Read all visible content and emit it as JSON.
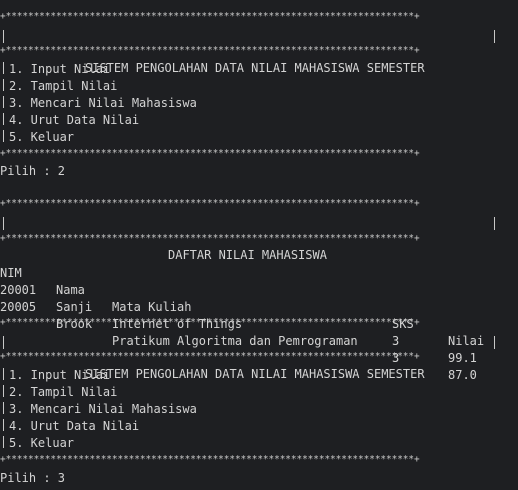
{
  "block1": {
    "border_top": "+*************************************************************************+",
    "title": "SISTEM PENGOLAHAN DATA NILAI MAHASISWA SEMESTER",
    "border_mid": "+*************************************************************************+",
    "menu": [
      "1. Input Nilai",
      "2. Tampil Nilai",
      "3. Mencari Nilai Mahasiswa",
      "4. Urut Data Nilai",
      "5. Keluar"
    ],
    "border_bottom": "+*************************************************************************+",
    "prompt": "Pilih : 2"
  },
  "block2": {
    "border_top": "+*************************************************************************+",
    "title": "DAFTAR NILAI MAHASISWA",
    "border_mid": "+*************************************************************************+",
    "headers": {
      "nim": "NIM",
      "nama": "Nama",
      "mk": "Mata Kuliah",
      "sks": "SKS",
      "nilai": "Nilai"
    },
    "rows": [
      {
        "nim": "20001",
        "nama": "Sanji",
        "mk": "Internet of Things",
        "sks": "3",
        "nilai": "99.1"
      },
      {
        "nim": "20005",
        "nama": "Brook",
        "mk": "Pratikum Algoritma dan Pemrograman",
        "sks": "3",
        "nilai": "87.0"
      }
    ]
  },
  "block3": {
    "border_top": "+*************************************************************************+",
    "title": "SISTEM PENGOLAHAN DATA NILAI MAHASISWA SEMESTER",
    "border_mid": "+*************************************************************************+",
    "menu": [
      "1. Input Nilai",
      "2. Tampil Nilai",
      "3. Mencari Nilai Mahasiswa",
      "4. Urut Data Nilai",
      "5. Keluar"
    ],
    "border_bottom": "+*************************************************************************+",
    "prompt": "Pilih : 3"
  },
  "colors": {
    "background": "#1e1f22",
    "text": "#d4d4d4",
    "border": "#c8c8c8"
  }
}
